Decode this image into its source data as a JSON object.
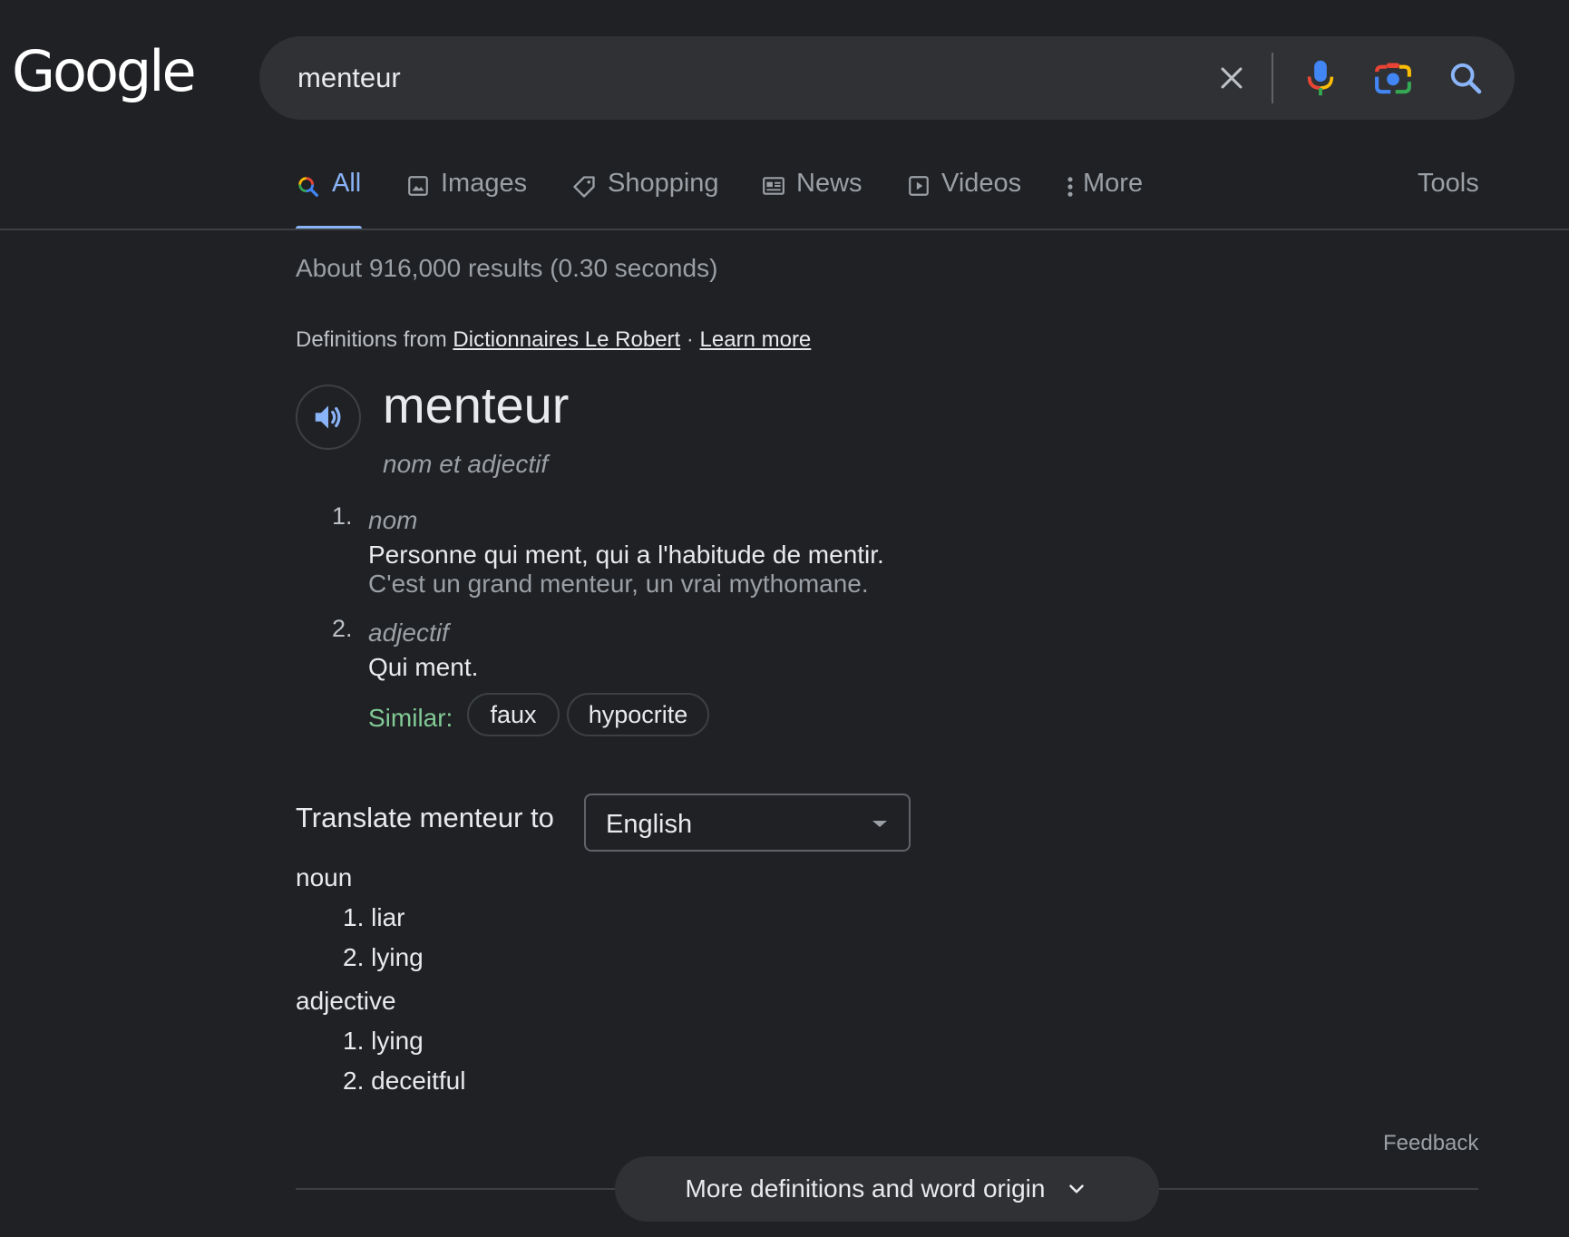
{
  "header": {
    "logo_text": "Google",
    "search_value": "menteur"
  },
  "tabs": [
    {
      "label": "All",
      "icon": "search-icon",
      "active": true
    },
    {
      "label": "Images",
      "icon": "image-icon"
    },
    {
      "label": "Shopping",
      "icon": "tag-icon"
    },
    {
      "label": "News",
      "icon": "newspaper-icon"
    },
    {
      "label": "Videos",
      "icon": "play-icon"
    },
    {
      "label": "More",
      "icon": "more-vert-icon"
    }
  ],
  "tools_label": "Tools",
  "result_stats": "About 916,000 results (0.30 seconds)",
  "definitions": {
    "from_prefix": "Definitions from",
    "source_link": "Dictionnaires Le Robert",
    "separator": "·",
    "learn_more": "Learn more",
    "word": "menteur",
    "word_pos": "nom et adjectif",
    "senses": [
      {
        "number": "1.",
        "pos": "nom",
        "definition": "Personne qui ment, qui a l'habitude de mentir.",
        "example": "C'est un grand menteur, un vrai mythomane."
      },
      {
        "number": "2.",
        "pos": "adjectif",
        "definition": "Qui ment.",
        "similar_label": "Similar:",
        "similar": [
          "faux",
          "hypocrite"
        ]
      }
    ]
  },
  "translate": {
    "label": "Translate menteur to",
    "language": "English",
    "groups": [
      {
        "pos": "noun",
        "items": [
          "1. liar",
          "2. lying"
        ]
      },
      {
        "pos": "adjective",
        "items": [
          "1. lying",
          "2. deceitful"
        ]
      }
    ]
  },
  "feedback": "Feedback",
  "more_definitions": "More definitions and word origin",
  "colors": {
    "background": "#202124",
    "accent_blue": "#8ab4f8",
    "similar_green": "#81c995",
    "muted_text": "#9aa0a6"
  }
}
